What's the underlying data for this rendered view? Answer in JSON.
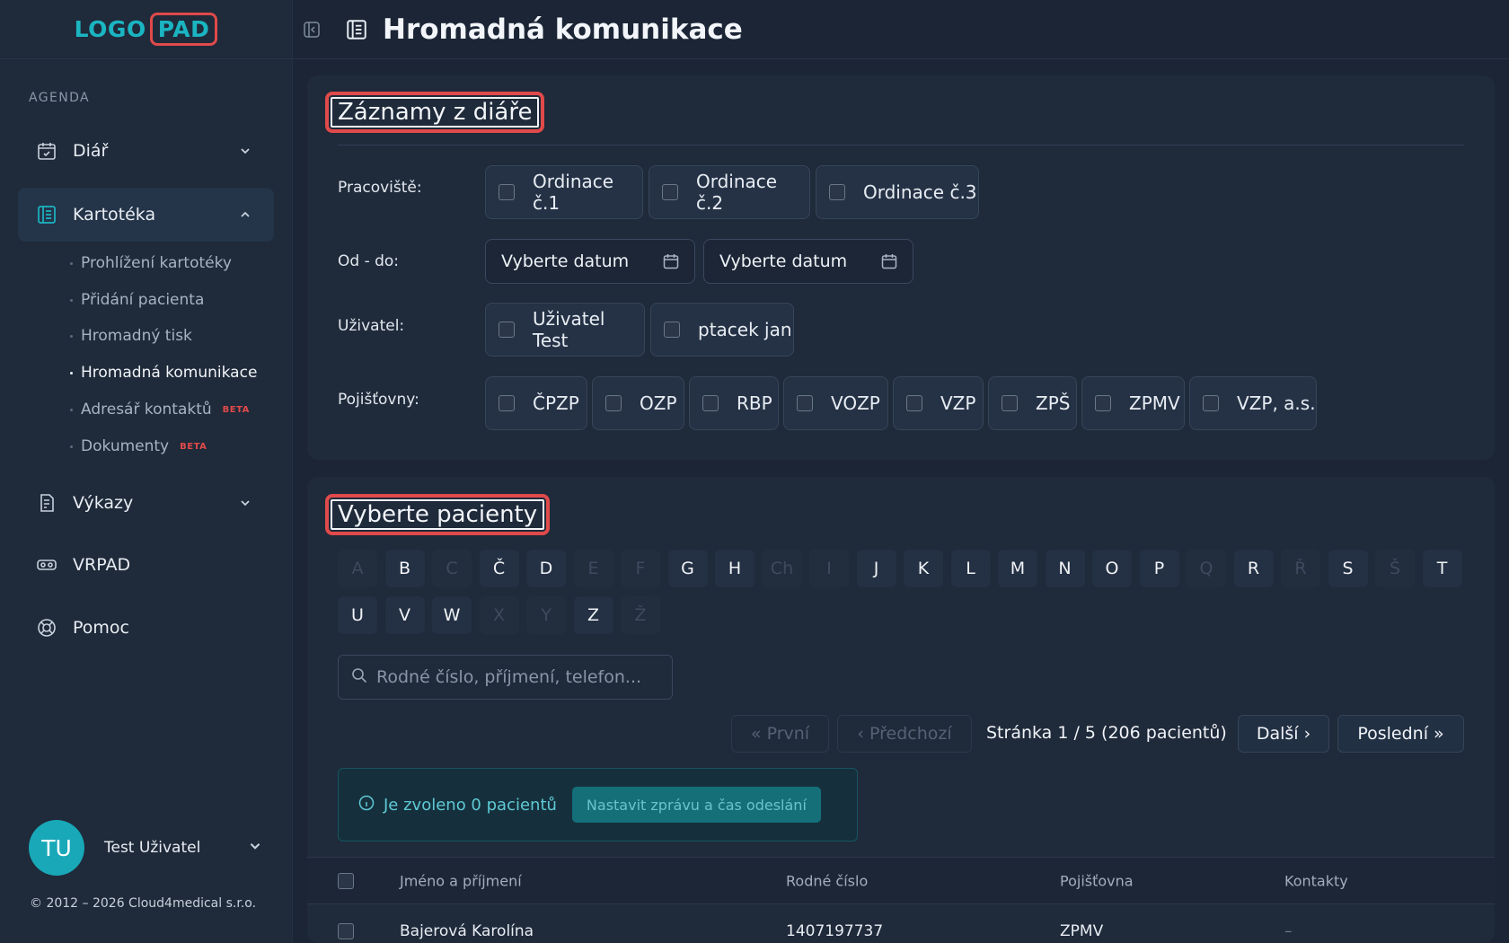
{
  "logo": {
    "part1": "LOGO",
    "part2": "PAD"
  },
  "sidebar": {
    "section_label": "AGENDA",
    "items": [
      {
        "label": "Diář"
      },
      {
        "label": "Kartotéka"
      },
      {
        "label": "Výkazy"
      },
      {
        "label": "VRPAD"
      },
      {
        "label": "Pomoc"
      }
    ],
    "sub_items": [
      {
        "label": "Prohlížení kartotéky"
      },
      {
        "label": "Přidání pacienta"
      },
      {
        "label": "Hromadný tisk"
      },
      {
        "label": "Hromadná komunikace"
      },
      {
        "label": "Adresář kontaktů",
        "badge": "BETA"
      },
      {
        "label": "Dokumenty",
        "badge": "BETA"
      }
    ],
    "user": {
      "initials": "TU",
      "name": "Test Uživatel"
    },
    "copyright": "© 2012 – 2026 Cloud4medical s.r.o."
  },
  "header": {
    "title": "Hromadná komunikace"
  },
  "records": {
    "heading": "Záznamy z diáře",
    "workplace_label": "Pracoviště:",
    "workplaces": [
      "Ordinace č.1",
      "Ordinace č.2",
      "Ordinace č.3"
    ],
    "date_label": "Od - do:",
    "date_from_placeholder": "Vyberte datum",
    "date_to_placeholder": "Vyberte datum",
    "user_label": "Uživatel:",
    "users": [
      "Uživatel Test",
      "ptacek jan"
    ],
    "insurers_label": "Pojišťovny:",
    "insurers": [
      "ČPZP",
      "OZP",
      "RBP",
      "VOZP",
      "VZP",
      "ZPŠ",
      "ZPMV",
      "VZP, a.s."
    ]
  },
  "patients": {
    "heading": "Vyberte pacienty",
    "letters_row1": [
      "A",
      "B",
      "C",
      "Č",
      "D",
      "E",
      "F",
      "G",
      "H",
      "Ch",
      "I",
      "J",
      "K",
      "L",
      "M",
      "N",
      "O",
      "P",
      "Q",
      "R",
      "Ř",
      "S",
      "Š",
      "T"
    ],
    "letters_row1_disabled": [
      "A",
      "C",
      "E",
      "F",
      "Ch",
      "I",
      "Q",
      "Ř",
      "Š"
    ],
    "letters_row2": [
      "U",
      "V",
      "W",
      "X",
      "Y",
      "Z",
      "Ž"
    ],
    "letters_row2_disabled": [
      "X",
      "Y",
      "Ž"
    ],
    "search_placeholder": "Rodné číslo, příjmení, telefon...",
    "pagination": {
      "first": "« První",
      "prev": "‹ Předchozí",
      "info": "Stránka 1 / 5 (206 pacientů)",
      "next": "Další ›",
      "last": "Poslední »"
    },
    "selection_text": "Je zvoleno 0 pacientů",
    "set_message_button": "Nastavit zprávu a čas odeslání",
    "table": {
      "columns": [
        "Jméno a příjmení",
        "Rodné číslo",
        "Pojišťovna",
        "Kontakty"
      ],
      "rows": [
        {
          "name": "Bajerová Karolína",
          "birth_number": "1407197737",
          "insurer": "ZPMV",
          "contacts": "–"
        }
      ]
    }
  },
  "colors": {
    "accent": "#1bb5c2",
    "highlight": "#e04a4a",
    "background": "#1b2535"
  }
}
